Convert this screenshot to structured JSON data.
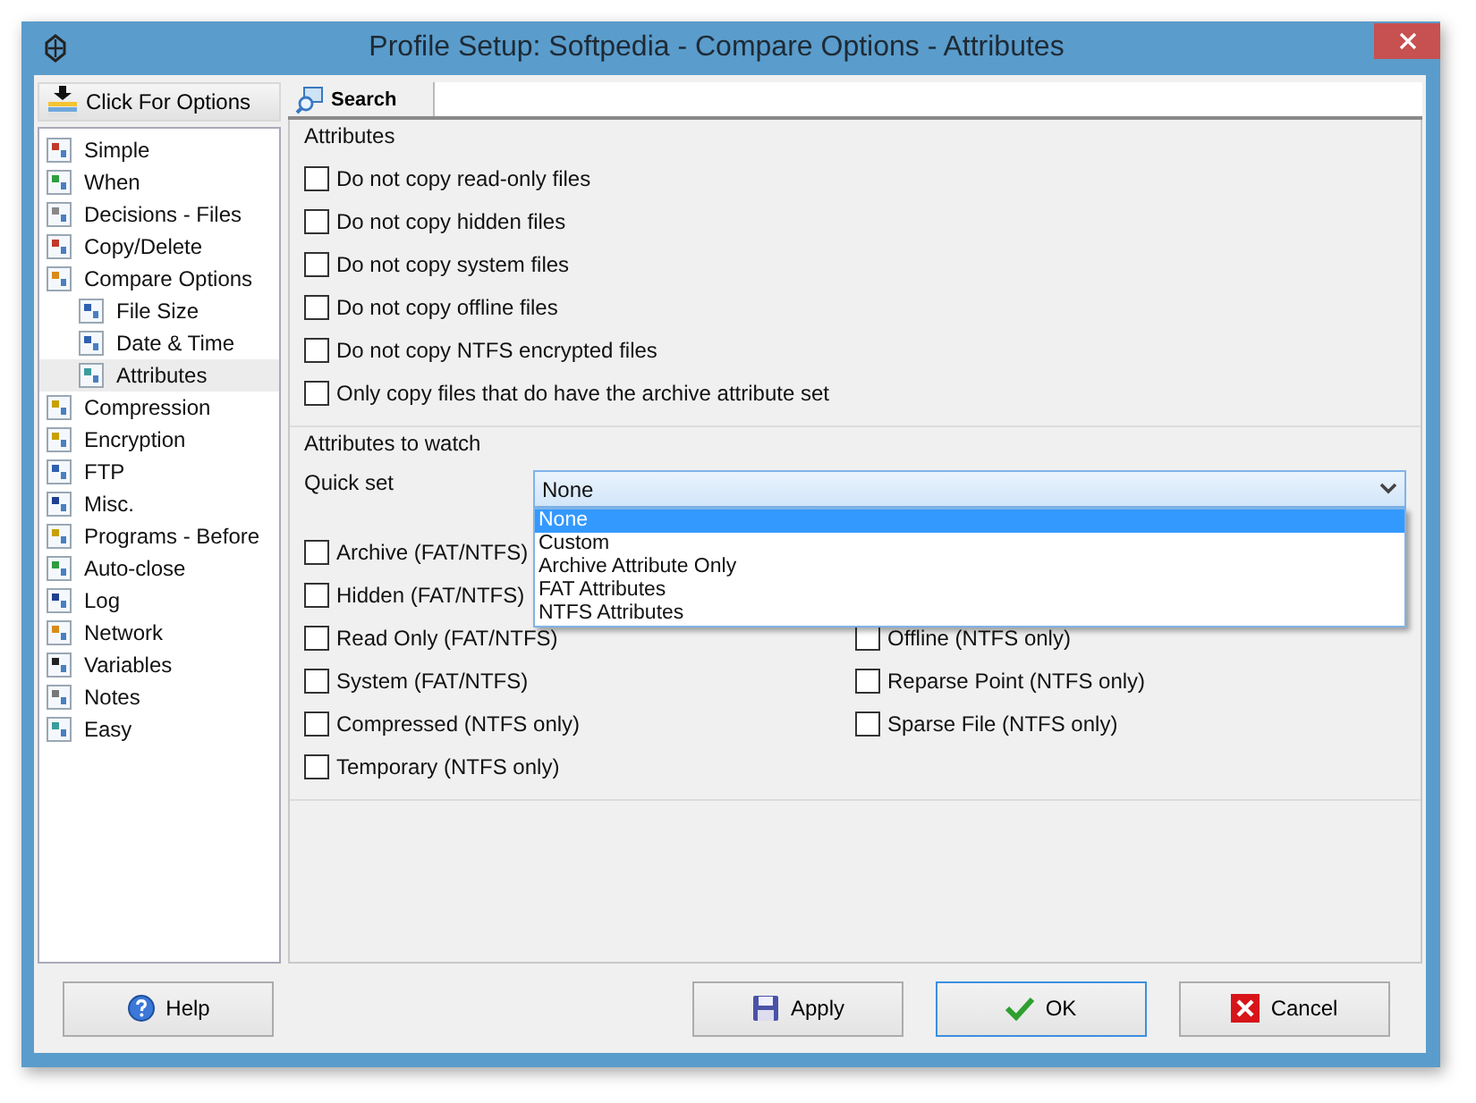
{
  "window": {
    "title": "Profile Setup: Softpedia - Compare Options - Attributes"
  },
  "sidebar": {
    "header": "Click For Options",
    "items": [
      {
        "label": "Simple",
        "selected": false
      },
      {
        "label": "When",
        "selected": false
      },
      {
        "label": "Decisions - Files",
        "selected": false
      },
      {
        "label": "Copy/Delete",
        "selected": false
      },
      {
        "label": "Compare Options",
        "selected": false,
        "children": [
          {
            "label": "File Size",
            "selected": false
          },
          {
            "label": "Date & Time",
            "selected": false
          },
          {
            "label": "Attributes",
            "selected": true
          }
        ]
      },
      {
        "label": "Compression",
        "selected": false
      },
      {
        "label": "Encryption",
        "selected": false
      },
      {
        "label": "FTP",
        "selected": false
      },
      {
        "label": "Misc.",
        "selected": false
      },
      {
        "label": "Programs - Before",
        "selected": false
      },
      {
        "label": "Auto-close",
        "selected": false
      },
      {
        "label": "Log",
        "selected": false
      },
      {
        "label": "Network",
        "selected": false
      },
      {
        "label": "Variables",
        "selected": false
      },
      {
        "label": "Notes",
        "selected": false
      },
      {
        "label": "Easy",
        "selected": false
      }
    ]
  },
  "toolbar": {
    "search_tab": "Search"
  },
  "attributes": {
    "title": "Attributes",
    "options": [
      {
        "label": "Do not copy read-only files",
        "checked": false
      },
      {
        "label": "Do not copy hidden files",
        "checked": false
      },
      {
        "label": "Do not copy system files",
        "checked": false
      },
      {
        "label": "Do not copy offline files",
        "checked": false
      },
      {
        "label": "Do not copy NTFS encrypted files",
        "checked": false
      },
      {
        "label": "Only copy files that do have the archive attribute set",
        "checked": false
      }
    ]
  },
  "attributes_to_watch": {
    "title": "Attributes to watch",
    "quick_set": {
      "label": "Quick set",
      "value": "None",
      "open": true,
      "options": [
        {
          "label": "None",
          "selected": true
        },
        {
          "label": "Custom",
          "selected": false
        },
        {
          "label": "Archive Attribute Only",
          "selected": false
        },
        {
          "label": "FAT Attributes",
          "selected": false
        },
        {
          "label": "NTFS Attributes",
          "selected": false
        }
      ]
    },
    "left_options": [
      {
        "label": "Archive (FAT/NTFS)",
        "checked": false
      },
      {
        "label": "Hidden (FAT/NTFS)",
        "checked": false
      },
      {
        "label": "Read Only (FAT/NTFS)",
        "checked": false
      },
      {
        "label": "System (FAT/NTFS)",
        "checked": false
      },
      {
        "label": "Compressed (NTFS only)",
        "checked": false
      },
      {
        "label": "Temporary (NTFS only)",
        "checked": false
      }
    ],
    "right_options": [
      {
        "label": "Offline (NTFS only)",
        "checked": false
      },
      {
        "label": "Reparse Point (NTFS only)",
        "checked": false
      },
      {
        "label": "Sparse File (NTFS only)",
        "checked": false
      }
    ]
  },
  "buttons": [
    {
      "label": "Help",
      "kind": "help",
      "focused": false
    },
    {
      "label": "Apply",
      "kind": "apply",
      "focused": false
    },
    {
      "label": "OK",
      "kind": "ok",
      "focused": true
    },
    {
      "label": "Cancel",
      "kind": "cancel",
      "focused": false
    }
  ]
}
